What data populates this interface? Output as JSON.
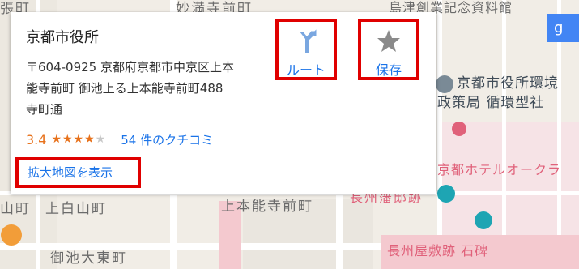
{
  "map": {
    "labels": {
      "top_left": "張町",
      "top_mid": "妙満寺前町",
      "top_right": "島津創業記念資料館",
      "city_hall_env_1": "京都市役所環境",
      "city_hall_env_2": "政策局 循環型社",
      "hotel": "京都ホテルオークラ",
      "honnoji": "上本能寺前町",
      "nagashu": "長州藩邸跡",
      "nagashu_stone": "長州屋敷跡 石碑",
      "oike_higashi": "御池大東町",
      "left_side": "山町",
      "left_side_2": "上白山町"
    },
    "colors": {
      "road": "#ffffff",
      "poi_red": "#e0617a",
      "poi_teal": "#1ea5b3",
      "poi_orange": "#f29d39"
    }
  },
  "card": {
    "title": "京都市役所",
    "address_line1": "〒604-0925 京都府京都市中京区上本",
    "address_line2": "能寺前町 御池上る上本能寺前町488",
    "address_line3": "寺町通",
    "rating": "3.4",
    "stars_filled": "★★★★",
    "stars_empty": "★",
    "rating_value": 3.4,
    "reviews_text": "54 件のクチコミ",
    "enlarge_link": "拡大地図を表示",
    "route_label": "ルート",
    "save_label": "保存",
    "route_icon": "directions-icon",
    "save_icon": "star-icon",
    "accent_color": "#1a73e8",
    "rating_color": "#e7711b",
    "highlight_color": "#e00000"
  },
  "side_button": {
    "label": "g"
  }
}
